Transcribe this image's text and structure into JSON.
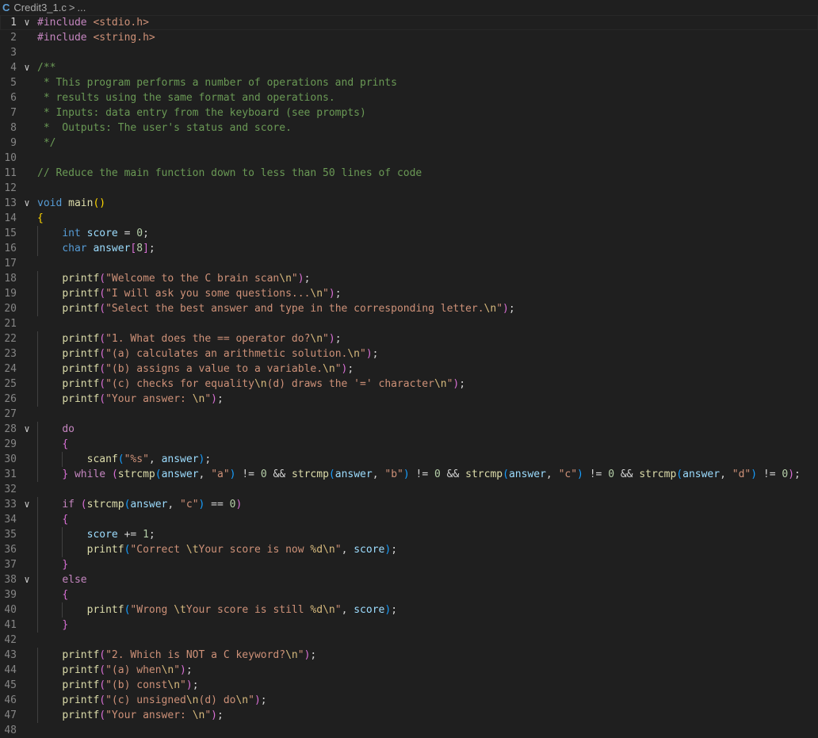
{
  "breadcrumb": {
    "lang_icon": "C",
    "file": "Credit3_1.c",
    "separator": ">",
    "more": "..."
  },
  "editor": {
    "current_line": 1,
    "lines": [
      {
        "n": "1",
        "fold": true,
        "indent": 0,
        "tokens": [
          [
            "pp",
            "#include "
          ],
          [
            "inc",
            "<stdio.h>"
          ]
        ]
      },
      {
        "n": "2",
        "indent": 0,
        "tokens": [
          [
            "pp",
            "#include "
          ],
          [
            "inc",
            "<string.h>"
          ]
        ]
      },
      {
        "n": "3",
        "indent": 0,
        "tokens": []
      },
      {
        "n": "4",
        "fold": true,
        "indent": 0,
        "tokens": [
          [
            "cm",
            "/**"
          ]
        ]
      },
      {
        "n": "5",
        "indent": 0,
        "tokens": [
          [
            "cm",
            " * This program performs a number of operations and prints"
          ]
        ]
      },
      {
        "n": "6",
        "indent": 0,
        "tokens": [
          [
            "cm",
            " * results using the same format and operations."
          ]
        ]
      },
      {
        "n": "7",
        "indent": 0,
        "tokens": [
          [
            "cm",
            " * Inputs: data entry from the keyboard (see prompts)"
          ]
        ]
      },
      {
        "n": "8",
        "indent": 0,
        "tokens": [
          [
            "cm",
            " *  Outputs: The user's status and score."
          ]
        ]
      },
      {
        "n": "9",
        "indent": 0,
        "tokens": [
          [
            "cm",
            " */"
          ]
        ]
      },
      {
        "n": "10",
        "indent": 0,
        "tokens": []
      },
      {
        "n": "11",
        "indent": 0,
        "tokens": [
          [
            "cm",
            "// Reduce the main function down to less than 50 lines of code"
          ]
        ]
      },
      {
        "n": "12",
        "indent": 0,
        "tokens": []
      },
      {
        "n": "13",
        "fold": true,
        "indent": 0,
        "tokens": [
          [
            "kw",
            "void "
          ],
          [
            "fn",
            "main"
          ],
          [
            "b1",
            "()"
          ]
        ]
      },
      {
        "n": "14",
        "indent": 0,
        "tokens": [
          [
            "b1",
            "{"
          ]
        ]
      },
      {
        "n": "15",
        "indent": 1,
        "tokens": [
          [
            "kw",
            "int "
          ],
          [
            "var",
            "score"
          ],
          [
            "op",
            " = "
          ],
          [
            "num",
            "0"
          ],
          [
            "pl",
            ";"
          ]
        ]
      },
      {
        "n": "16",
        "indent": 1,
        "tokens": [
          [
            "kw",
            "char "
          ],
          [
            "var",
            "answer"
          ],
          [
            "b2",
            "["
          ],
          [
            "num",
            "8"
          ],
          [
            "b2",
            "]"
          ],
          [
            "pl",
            ";"
          ]
        ]
      },
      {
        "n": "17",
        "indent": 1,
        "tokens": []
      },
      {
        "n": "18",
        "indent": 1,
        "tokens": [
          [
            "fn",
            "printf"
          ],
          [
            "b2",
            "("
          ],
          [
            "str",
            "\"Welcome to the C brain scan"
          ],
          [
            "esc",
            "\\n"
          ],
          [
            "str",
            "\""
          ],
          [
            "b2",
            ")"
          ],
          [
            "pl",
            ";"
          ]
        ]
      },
      {
        "n": "19",
        "indent": 1,
        "tokens": [
          [
            "fn",
            "printf"
          ],
          [
            "b2",
            "("
          ],
          [
            "str",
            "\"I will ask you some questions..."
          ],
          [
            "esc",
            "\\n"
          ],
          [
            "str",
            "\""
          ],
          [
            "b2",
            ")"
          ],
          [
            "pl",
            ";"
          ]
        ]
      },
      {
        "n": "20",
        "indent": 1,
        "tokens": [
          [
            "fn",
            "printf"
          ],
          [
            "b2",
            "("
          ],
          [
            "str",
            "\"Select the best answer and type in the corresponding letter."
          ],
          [
            "esc",
            "\\n"
          ],
          [
            "str",
            "\""
          ],
          [
            "b2",
            ")"
          ],
          [
            "pl",
            ";"
          ]
        ]
      },
      {
        "n": "21",
        "indent": 1,
        "tokens": []
      },
      {
        "n": "22",
        "indent": 1,
        "tokens": [
          [
            "fn",
            "printf"
          ],
          [
            "b2",
            "("
          ],
          [
            "str",
            "\"1. What does the == operator do?"
          ],
          [
            "esc",
            "\\n"
          ],
          [
            "str",
            "\""
          ],
          [
            "b2",
            ")"
          ],
          [
            "pl",
            ";"
          ]
        ]
      },
      {
        "n": "23",
        "indent": 1,
        "tokens": [
          [
            "fn",
            "printf"
          ],
          [
            "b2",
            "("
          ],
          [
            "str",
            "\"(a) calculates an arithmetic solution."
          ],
          [
            "esc",
            "\\n"
          ],
          [
            "str",
            "\""
          ],
          [
            "b2",
            ")"
          ],
          [
            "pl",
            ";"
          ]
        ]
      },
      {
        "n": "24",
        "indent": 1,
        "tokens": [
          [
            "fn",
            "printf"
          ],
          [
            "b2",
            "("
          ],
          [
            "str",
            "\"(b) assigns a value to a variable."
          ],
          [
            "esc",
            "\\n"
          ],
          [
            "str",
            "\""
          ],
          [
            "b2",
            ")"
          ],
          [
            "pl",
            ";"
          ]
        ]
      },
      {
        "n": "25",
        "indent": 1,
        "tokens": [
          [
            "fn",
            "printf"
          ],
          [
            "b2",
            "("
          ],
          [
            "str",
            "\"(c) checks for equality"
          ],
          [
            "esc",
            "\\n"
          ],
          [
            "str",
            "(d) draws the '=' character"
          ],
          [
            "esc",
            "\\n"
          ],
          [
            "str",
            "\""
          ],
          [
            "b2",
            ")"
          ],
          [
            "pl",
            ";"
          ]
        ]
      },
      {
        "n": "26",
        "indent": 1,
        "tokens": [
          [
            "fn",
            "printf"
          ],
          [
            "b2",
            "("
          ],
          [
            "str",
            "\"Your answer: "
          ],
          [
            "esc",
            "\\n"
          ],
          [
            "str",
            "\""
          ],
          [
            "b2",
            ")"
          ],
          [
            "pl",
            ";"
          ]
        ]
      },
      {
        "n": "27",
        "indent": 1,
        "tokens": []
      },
      {
        "n": "28",
        "fold": true,
        "indent": 1,
        "tokens": [
          [
            "ctl",
            "do"
          ]
        ]
      },
      {
        "n": "29",
        "indent": 1,
        "tokens": [
          [
            "b2",
            "{"
          ]
        ]
      },
      {
        "n": "30",
        "indent": 2,
        "tokens": [
          [
            "fn",
            "scanf"
          ],
          [
            "b3",
            "("
          ],
          [
            "str",
            "\"%s\""
          ],
          [
            "pl",
            ", "
          ],
          [
            "var",
            "answer"
          ],
          [
            "b3",
            ")"
          ],
          [
            "pl",
            ";"
          ]
        ]
      },
      {
        "n": "31",
        "indent": 1,
        "tokens": [
          [
            "b2",
            "}"
          ],
          [
            "ctl",
            " while "
          ],
          [
            "b2",
            "("
          ],
          [
            "fn",
            "strcmp"
          ],
          [
            "b3",
            "("
          ],
          [
            "var",
            "answer"
          ],
          [
            "pl",
            ", "
          ],
          [
            "str",
            "\"a\""
          ],
          [
            "b3",
            ")"
          ],
          [
            "op",
            " != "
          ],
          [
            "num",
            "0"
          ],
          [
            "op",
            " && "
          ],
          [
            "fn",
            "strcmp"
          ],
          [
            "b3",
            "("
          ],
          [
            "var",
            "answer"
          ],
          [
            "pl",
            ", "
          ],
          [
            "str",
            "\"b\""
          ],
          [
            "b3",
            ")"
          ],
          [
            "op",
            " != "
          ],
          [
            "num",
            "0"
          ],
          [
            "op",
            " && "
          ],
          [
            "fn",
            "strcmp"
          ],
          [
            "b3",
            "("
          ],
          [
            "var",
            "answer"
          ],
          [
            "pl",
            ", "
          ],
          [
            "str",
            "\"c\""
          ],
          [
            "b3",
            ")"
          ],
          [
            "op",
            " != "
          ],
          [
            "num",
            "0"
          ],
          [
            "op",
            " && "
          ],
          [
            "fn",
            "strcmp"
          ],
          [
            "b3",
            "("
          ],
          [
            "var",
            "answer"
          ],
          [
            "pl",
            ", "
          ],
          [
            "str",
            "\"d\""
          ],
          [
            "b3",
            ")"
          ],
          [
            "op",
            " != "
          ],
          [
            "num",
            "0"
          ],
          [
            "b2",
            ")"
          ],
          [
            "pl",
            ";"
          ]
        ]
      },
      {
        "n": "32",
        "indent": 1,
        "tokens": []
      },
      {
        "n": "33",
        "fold": true,
        "indent": 1,
        "tokens": [
          [
            "ctl",
            "if "
          ],
          [
            "b2",
            "("
          ],
          [
            "fn",
            "strcmp"
          ],
          [
            "b3",
            "("
          ],
          [
            "var",
            "answer"
          ],
          [
            "pl",
            ", "
          ],
          [
            "str",
            "\"c\""
          ],
          [
            "b3",
            ")"
          ],
          [
            "op",
            " == "
          ],
          [
            "num",
            "0"
          ],
          [
            "b2",
            ")"
          ]
        ]
      },
      {
        "n": "34",
        "indent": 1,
        "tokens": [
          [
            "b2",
            "{"
          ]
        ]
      },
      {
        "n": "35",
        "indent": 2,
        "tokens": [
          [
            "var",
            "score"
          ],
          [
            "op",
            " += "
          ],
          [
            "num",
            "1"
          ],
          [
            "pl",
            ";"
          ]
        ]
      },
      {
        "n": "36",
        "indent": 2,
        "tokens": [
          [
            "fn",
            "printf"
          ],
          [
            "b3",
            "("
          ],
          [
            "str",
            "\"Correct "
          ],
          [
            "esc",
            "\\t"
          ],
          [
            "str",
            "Your score is now "
          ],
          [
            "esc",
            "%d\\n"
          ],
          [
            "str",
            "\""
          ],
          [
            "pl",
            ", "
          ],
          [
            "var",
            "score"
          ],
          [
            "b3",
            ")"
          ],
          [
            "pl",
            ";"
          ]
        ]
      },
      {
        "n": "37",
        "indent": 1,
        "tokens": [
          [
            "b2",
            "}"
          ]
        ]
      },
      {
        "n": "38",
        "fold": true,
        "indent": 1,
        "tokens": [
          [
            "ctl",
            "else"
          ]
        ]
      },
      {
        "n": "39",
        "indent": 1,
        "tokens": [
          [
            "b2",
            "{"
          ]
        ]
      },
      {
        "n": "40",
        "indent": 2,
        "tokens": [
          [
            "fn",
            "printf"
          ],
          [
            "b3",
            "("
          ],
          [
            "str",
            "\"Wrong "
          ],
          [
            "esc",
            "\\t"
          ],
          [
            "str",
            "Your score is still "
          ],
          [
            "esc",
            "%d\\n"
          ],
          [
            "str",
            "\""
          ],
          [
            "pl",
            ", "
          ],
          [
            "var",
            "score"
          ],
          [
            "b3",
            ")"
          ],
          [
            "pl",
            ";"
          ]
        ]
      },
      {
        "n": "41",
        "indent": 1,
        "tokens": [
          [
            "b2",
            "}"
          ]
        ]
      },
      {
        "n": "42",
        "indent": 1,
        "tokens": []
      },
      {
        "n": "43",
        "indent": 1,
        "tokens": [
          [
            "fn",
            "printf"
          ],
          [
            "b2",
            "("
          ],
          [
            "str",
            "\"2. Which is NOT a C keyword?"
          ],
          [
            "esc",
            "\\n"
          ],
          [
            "str",
            "\""
          ],
          [
            "b2",
            ")"
          ],
          [
            "pl",
            ";"
          ]
        ]
      },
      {
        "n": "44",
        "indent": 1,
        "tokens": [
          [
            "fn",
            "printf"
          ],
          [
            "b2",
            "("
          ],
          [
            "str",
            "\"(a) when"
          ],
          [
            "esc",
            "\\n"
          ],
          [
            "str",
            "\""
          ],
          [
            "b2",
            ")"
          ],
          [
            "pl",
            ";"
          ]
        ]
      },
      {
        "n": "45",
        "indent": 1,
        "tokens": [
          [
            "fn",
            "printf"
          ],
          [
            "b2",
            "("
          ],
          [
            "str",
            "\"(b) const"
          ],
          [
            "esc",
            "\\n"
          ],
          [
            "str",
            "\""
          ],
          [
            "b2",
            ")"
          ],
          [
            "pl",
            ";"
          ]
        ]
      },
      {
        "n": "46",
        "indent": 1,
        "tokens": [
          [
            "fn",
            "printf"
          ],
          [
            "b2",
            "("
          ],
          [
            "str",
            "\"(c) unsigned"
          ],
          [
            "esc",
            "\\n"
          ],
          [
            "str",
            "(d) do"
          ],
          [
            "esc",
            "\\n"
          ],
          [
            "str",
            "\""
          ],
          [
            "b2",
            ")"
          ],
          [
            "pl",
            ";"
          ]
        ]
      },
      {
        "n": "47",
        "indent": 1,
        "tokens": [
          [
            "fn",
            "printf"
          ],
          [
            "b2",
            "("
          ],
          [
            "str",
            "\"Your answer: "
          ],
          [
            "esc",
            "\\n"
          ],
          [
            "str",
            "\""
          ],
          [
            "b2",
            ")"
          ],
          [
            "pl",
            ";"
          ]
        ]
      },
      {
        "n": "48",
        "indent": 1,
        "tokens": []
      }
    ]
  }
}
